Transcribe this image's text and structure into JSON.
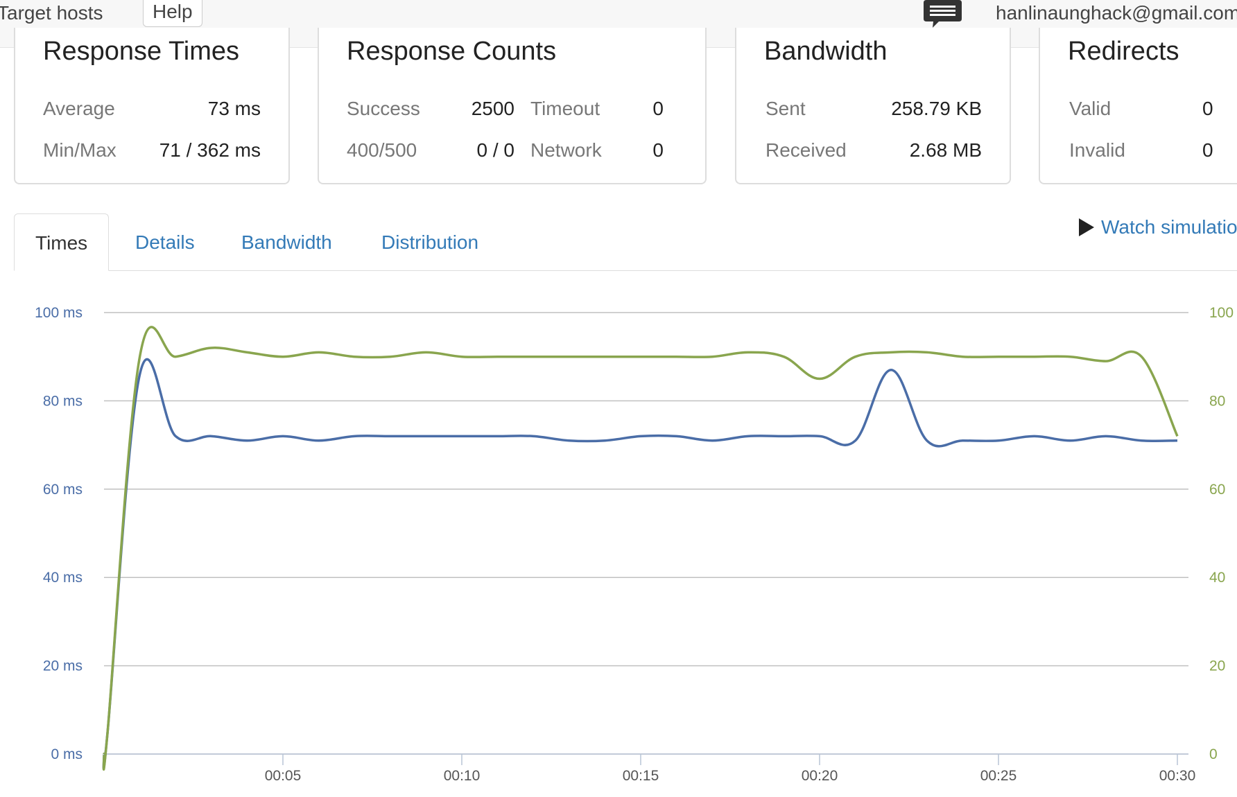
{
  "topbar": {
    "target_hosts": "Target hosts",
    "help": "Help",
    "chat_icon": "chat-bubble-icon",
    "user_email": "hanlinaunghack@gmail.com"
  },
  "cards": {
    "response_times": {
      "title": "Response Times",
      "average_label": "Average",
      "average_value": "73 ms",
      "minmax_label": "Min/Max",
      "minmax_value": "71 / 362 ms"
    },
    "response_counts": {
      "title": "Response Counts",
      "success_label": "Success",
      "success_value": "2500",
      "timeout_label": "Timeout",
      "timeout_value": "0",
      "errors_label": "400/500",
      "errors_value": "0 / 0",
      "network_label": "Network",
      "network_value": "0"
    },
    "bandwidth": {
      "title": "Bandwidth",
      "sent_label": "Sent",
      "sent_value": "258.79 KB",
      "received_label": "Received",
      "received_value": "2.68 MB"
    },
    "redirects": {
      "title": "Redirects",
      "valid_label": "Valid",
      "valid_value": "0",
      "invalid_label": "Invalid",
      "invalid_value": "0"
    }
  },
  "tabs": [
    {
      "label": "Times",
      "active": true
    },
    {
      "label": "Details",
      "active": false
    },
    {
      "label": "Bandwidth",
      "active": false
    },
    {
      "label": "Distribution",
      "active": false
    }
  ],
  "watch_simulation": {
    "label": "Watch simulation",
    "icon": "play-icon"
  },
  "colors": {
    "link": "#337ab7",
    "series_blue": "#4a6da7",
    "series_green": "#89a54e",
    "grid": "#c0c0c0"
  },
  "chart_data": {
    "type": "line",
    "grid": true,
    "y_left": {
      "range": [
        0,
        100
      ],
      "ticks": [
        "0 ms",
        "20 ms",
        "40 ms",
        "60 ms",
        "80 ms",
        "100 ms"
      ],
      "tick_values": [
        0,
        20,
        40,
        60,
        80,
        100
      ]
    },
    "y_right": {
      "range": [
        0,
        100
      ],
      "ticks": [
        "0",
        "20",
        "40",
        "60",
        "80",
        "100"
      ],
      "tick_values": [
        0,
        20,
        40,
        60,
        80,
        100
      ]
    },
    "x_axis": {
      "range": [
        0,
        30
      ],
      "ticks": [
        "00:05",
        "00:10",
        "00:15",
        "00:20",
        "00:25",
        "00:30"
      ],
      "tick_values": [
        5,
        10,
        15,
        20,
        25,
        30
      ]
    },
    "series": [
      {
        "color": "#4a6da7",
        "axis": "left",
        "x": [
          0,
          0.1,
          1,
          2,
          3,
          4,
          5,
          6,
          7,
          8,
          9,
          10,
          11,
          12,
          13,
          14,
          15,
          16,
          17,
          18,
          19,
          20,
          21,
          22,
          23,
          24,
          25,
          26,
          27,
          28,
          29,
          30
        ],
        "y": [
          0,
          5,
          86,
          72,
          72,
          71,
          72,
          71,
          72,
          72,
          72,
          72,
          72,
          72,
          71,
          71,
          72,
          72,
          71,
          72,
          72,
          72,
          71,
          87,
          71,
          71,
          71,
          72,
          71,
          72,
          71,
          71
        ]
      },
      {
        "color": "#89a54e",
        "axis": "right",
        "x": [
          0,
          0.1,
          1,
          2,
          3,
          4,
          5,
          6,
          7,
          8,
          9,
          10,
          11,
          12,
          13,
          14,
          15,
          16,
          17,
          18,
          19,
          20,
          21,
          22,
          23,
          24,
          25,
          26,
          27,
          28,
          29,
          30
        ],
        "y": [
          0,
          5,
          90,
          90,
          92,
          91,
          90,
          91,
          90,
          90,
          91,
          90,
          90,
          90,
          90,
          90,
          90,
          90,
          90,
          91,
          90,
          85,
          90,
          91,
          91,
          90,
          90,
          90,
          90,
          89,
          90,
          72
        ]
      }
    ]
  }
}
